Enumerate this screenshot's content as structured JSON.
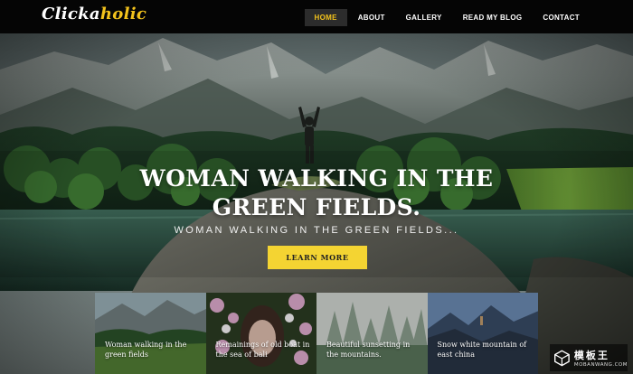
{
  "brand": {
    "logo_main": "Clicka",
    "logo_accent": "holic"
  },
  "nav": {
    "items": [
      {
        "label": "HOME",
        "active": true
      },
      {
        "label": "ABOUT",
        "active": false
      },
      {
        "label": "GALLERY",
        "active": false
      },
      {
        "label": "READ MY BLOG",
        "active": false
      },
      {
        "label": "CONTACT",
        "active": false
      }
    ]
  },
  "hero": {
    "headline": "WOMAN WALKING IN THE GREEN FIELDS.",
    "subheadline": "WOMAN WALKING IN THE GREEN FIELDS...",
    "cta_label": "LEARN MORE"
  },
  "gallery": {
    "cards": [
      {
        "caption": "Woman walking in the green fields"
      },
      {
        "caption": "Remainings of old boat in the sea of bali"
      },
      {
        "caption": "Beautiful sunsetting in the mountains."
      },
      {
        "caption": "Snow white mountain of east china"
      }
    ]
  },
  "watermark": {
    "cn": "模板王",
    "en": "MOBANWANG.COM"
  },
  "colors": {
    "accent": "#f2c21c",
    "cta_bg": "#f4d432",
    "navbar_bg": "#050505"
  }
}
